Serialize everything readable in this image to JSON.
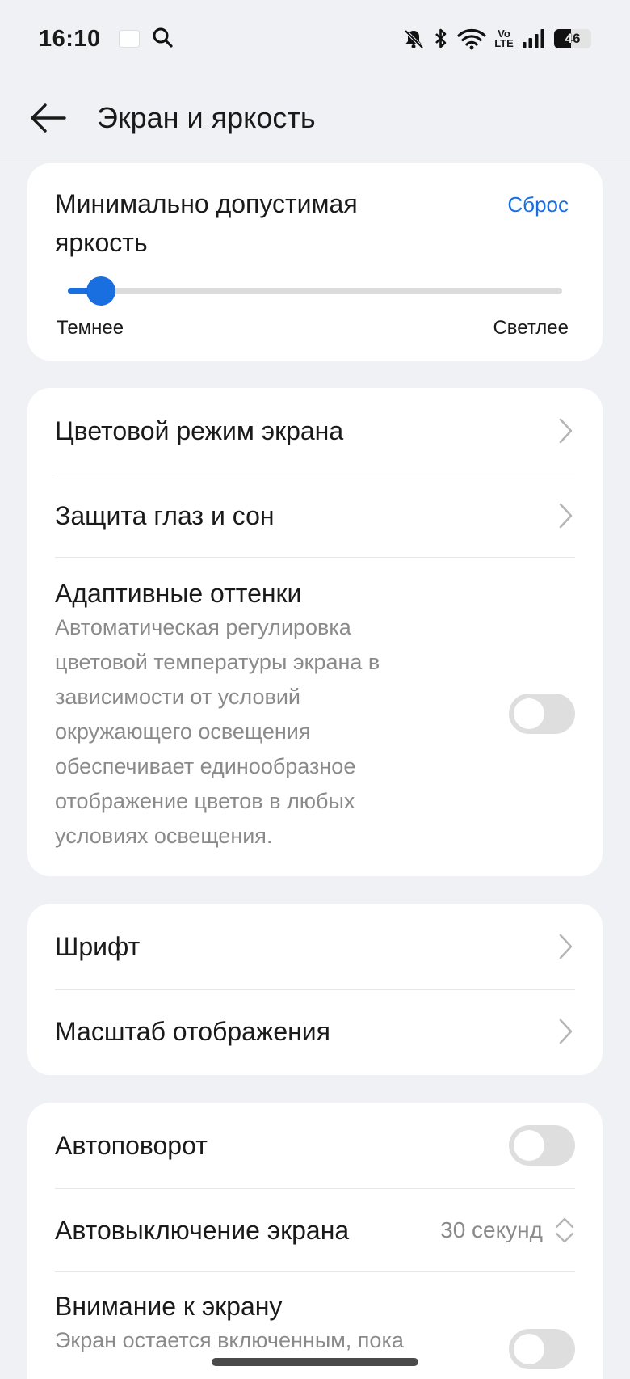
{
  "status_bar": {
    "time": "16:10",
    "battery_level": "46",
    "battery_fraction": 0.46,
    "icons": [
      "app-notification-icon",
      "search-icon",
      "bell-muted-icon",
      "bluetooth-icon",
      "wifi-icon",
      "volte-icon",
      "signal-icon",
      "battery-icon"
    ],
    "volte_top": "Vo",
    "volte_bottom": "LTE"
  },
  "header": {
    "title": "Экран и яркость",
    "back_icon": "arrow-left-icon"
  },
  "brightness": {
    "title": "Минимально допустимая яркость",
    "reset_label": "Сброс",
    "min_label": "Темнее",
    "max_label": "Светлее",
    "level": 0.04,
    "accent": "#1a6fe0"
  },
  "group1": {
    "color_mode": "Цветовой режим экрана",
    "eye_protection": "Защита глаз и сон",
    "adaptive_title": "Адаптивные оттенки",
    "adaptive_desc": "Автоматическая регулировка цветовой температуры экрана в зависимости от условий окружающего освещения обеспечивает единообразное отображение цветов в любых условиях освещения.",
    "adaptive_enabled": false
  },
  "group2": {
    "font": "Шрифт",
    "display_scale": "Масштаб отображения"
  },
  "group3": {
    "auto_rotate": "Автоповорот",
    "auto_rotate_enabled": false,
    "screen_timeout": "Автовыключение экрана",
    "screen_timeout_value": "30 секунд",
    "screen_attention": "Внимание к экрану",
    "screen_attention_desc": "Экран остается включенным, пока",
    "screen_attention_enabled": false
  }
}
